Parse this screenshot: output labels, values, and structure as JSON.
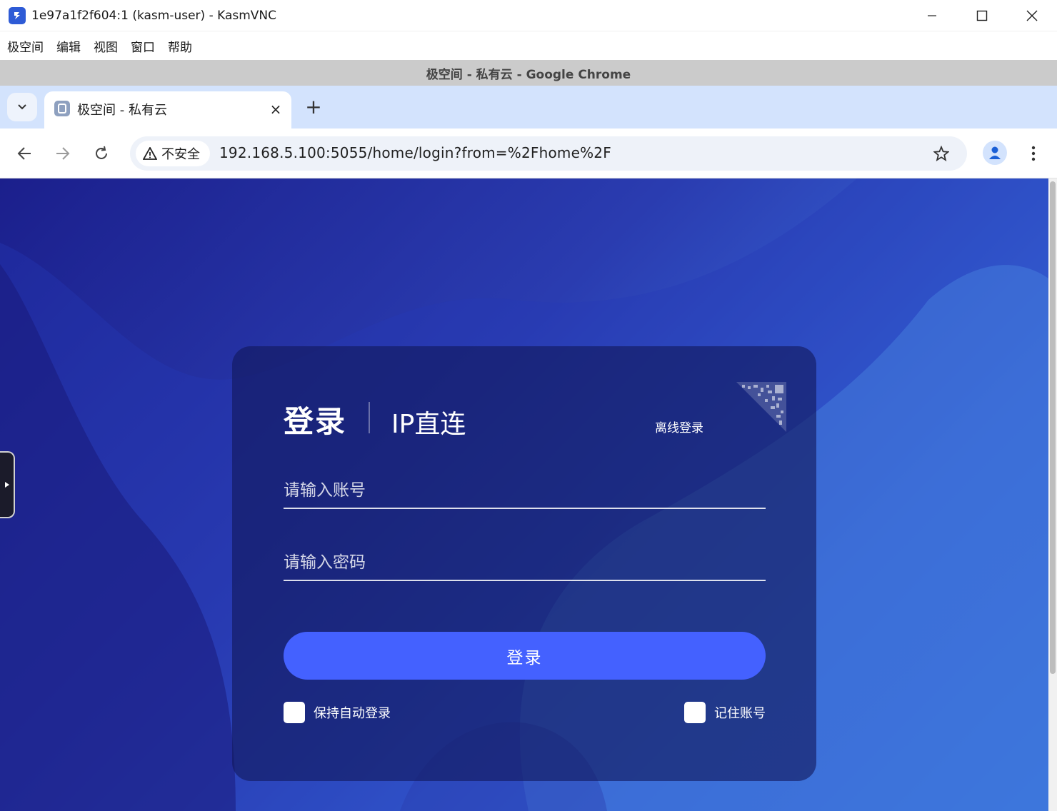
{
  "window": {
    "title": "1e97a1f2f604:1 (kasm-user) - KasmVNC",
    "app_icon": "kasmvnc-icon"
  },
  "vnc_menu": [
    "极空间",
    "编辑",
    "视图",
    "窗口",
    "帮助"
  ],
  "chrome": {
    "caption": "极空间 - 私有云 - Google Chrome",
    "tab": {
      "title": "极空间 - 私有云",
      "close": "×"
    },
    "new_tab": "+",
    "security_label": "不安全",
    "url": "192.168.5.100:5055/home/login?from=%2Fhome%2F"
  },
  "login": {
    "tab_login": "登录",
    "tab_ip": "IP直连",
    "offline_login": "离线登录",
    "account_placeholder": "请输入账号",
    "password_placeholder": "请输入密码",
    "submit": "登录",
    "keep_login": "保持自动登录",
    "remember_account": "记住账号"
  },
  "colors": {
    "accent": "#4461ff",
    "bg_start": "#1b1f8c",
    "bg_end": "#3c86ec"
  }
}
